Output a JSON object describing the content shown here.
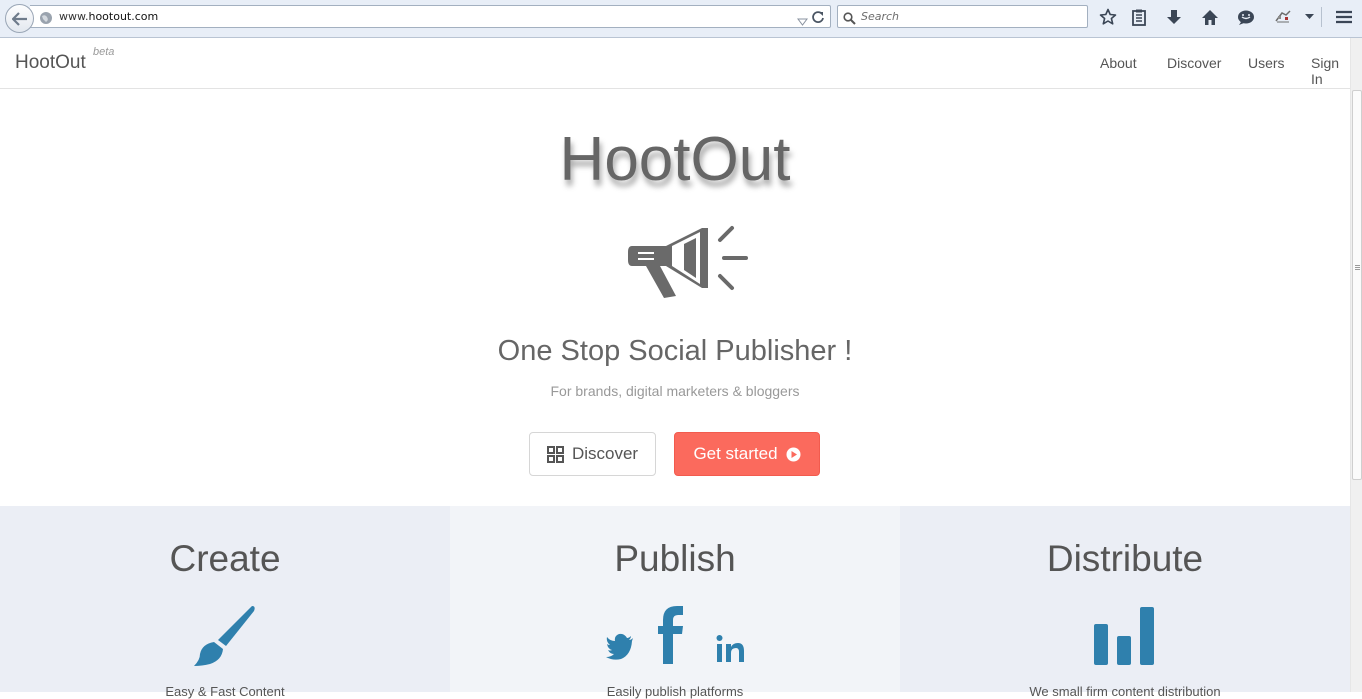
{
  "browser": {
    "url_prefix": "www.",
    "url_host": "hootout.com",
    "search_placeholder": "Search"
  },
  "navbar": {
    "brand": "HootOut",
    "badge": "beta",
    "links": [
      "About",
      "Discover",
      "Users",
      "Sign In"
    ]
  },
  "hero": {
    "title": "HootOut",
    "tagline": "One Stop Social Publisher !",
    "subtitle": "For brands, digital marketers & bloggers",
    "discover_label": "Discover",
    "start_label": "Get started"
  },
  "features": [
    {
      "title": "Create",
      "icon": "paintbrush-icon",
      "desc": "Easy & Fast Content"
    },
    {
      "title": "Publish",
      "icon": "social-icons",
      "desc": "Easily publish platforms"
    },
    {
      "title": "Distribute",
      "icon": "bar-chart-icon",
      "desc": "We small firm content distribution"
    }
  ],
  "colors": {
    "accent": "#fb6a5d",
    "feature_icon": "#2f80ad",
    "feature_bg_1": "#ebeef5",
    "feature_bg_2": "#f2f4f8",
    "text_gray": "#666666"
  }
}
